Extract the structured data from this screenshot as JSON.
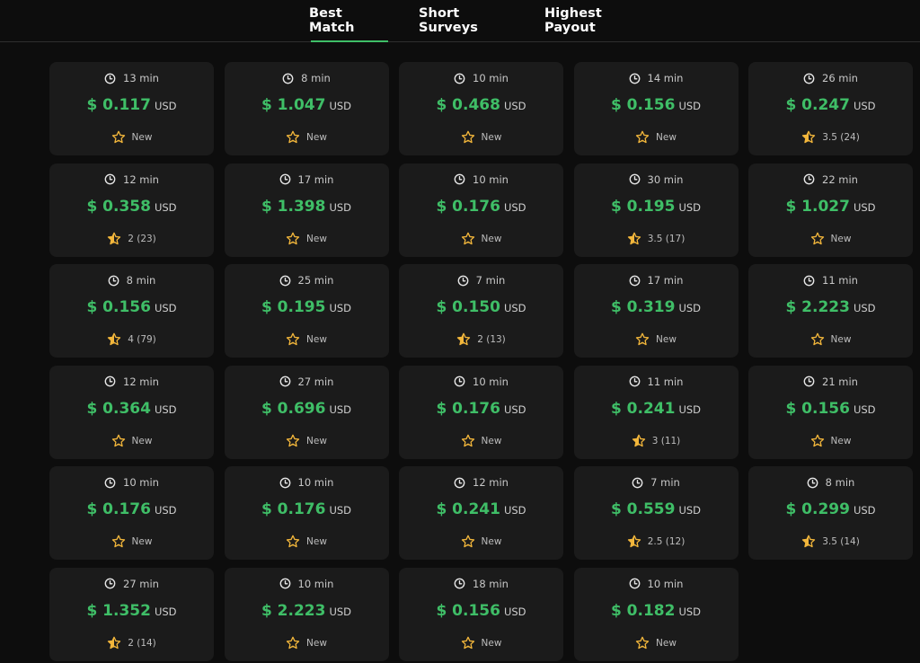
{
  "tabs": [
    {
      "label": "Best Match",
      "active": true
    },
    {
      "label": "Short Surveys",
      "active": false
    },
    {
      "label": "Highest Payout",
      "active": false
    }
  ],
  "colors": {
    "accent_green": "#3fbe67",
    "star_gold": "#f2b63b",
    "background": "#0d0d0d",
    "card": "#1b1b1b"
  },
  "currency": "USD",
  "surveys": [
    {
      "time": "13 min",
      "price": "$ 0.117",
      "rating": "New",
      "star": "empty-star-icon"
    },
    {
      "time": "8 min",
      "price": "$ 1.047",
      "rating": "New",
      "star": "empty-star-icon"
    },
    {
      "time": "10 min",
      "price": "$ 0.468",
      "rating": "New",
      "star": "empty-star-icon"
    },
    {
      "time": "14 min",
      "price": "$ 0.156",
      "rating": "New",
      "star": "empty-star-icon"
    },
    {
      "time": "26 min",
      "price": "$ 0.247",
      "rating": "3.5 (24)",
      "star": "half-star-icon"
    },
    {
      "time": "12 min",
      "price": "$ 0.358",
      "rating": "2 (23)",
      "star": "half-star-icon"
    },
    {
      "time": "17 min",
      "price": "$ 1.398",
      "rating": "New",
      "star": "empty-star-icon"
    },
    {
      "time": "10 min",
      "price": "$ 0.176",
      "rating": "New",
      "star": "empty-star-icon"
    },
    {
      "time": "30 min",
      "price": "$ 0.195",
      "rating": "3.5 (17)",
      "star": "half-star-icon"
    },
    {
      "time": "22 min",
      "price": "$ 1.027",
      "rating": "New",
      "star": "empty-star-icon"
    },
    {
      "time": "8 min",
      "price": "$ 0.156",
      "rating": "4 (79)",
      "star": "half-star-icon"
    },
    {
      "time": "25 min",
      "price": "$ 0.195",
      "rating": "New",
      "star": "empty-star-icon"
    },
    {
      "time": "7 min",
      "price": "$ 0.150",
      "rating": "2 (13)",
      "star": "half-star-icon"
    },
    {
      "time": "17 min",
      "price": "$ 0.319",
      "rating": "New",
      "star": "empty-star-icon"
    },
    {
      "time": "11 min",
      "price": "$ 2.223",
      "rating": "New",
      "star": "empty-star-icon"
    },
    {
      "time": "12 min",
      "price": "$ 0.364",
      "rating": "New",
      "star": "empty-star-icon"
    },
    {
      "time": "27 min",
      "price": "$ 0.696",
      "rating": "New",
      "star": "empty-star-icon"
    },
    {
      "time": "10 min",
      "price": "$ 0.176",
      "rating": "New",
      "star": "empty-star-icon"
    },
    {
      "time": "11 min",
      "price": "$ 0.241",
      "rating": "3 (11)",
      "star": "half-star-icon"
    },
    {
      "time": "21 min",
      "price": "$ 0.156",
      "rating": "New",
      "star": "empty-star-icon"
    },
    {
      "time": "10 min",
      "price": "$ 0.176",
      "rating": "New",
      "star": "empty-star-icon"
    },
    {
      "time": "10 min",
      "price": "$ 0.176",
      "rating": "New",
      "star": "empty-star-icon"
    },
    {
      "time": "12 min",
      "price": "$ 0.241",
      "rating": "New",
      "star": "empty-star-icon"
    },
    {
      "time": "7 min",
      "price": "$ 0.559",
      "rating": "2.5 (12)",
      "star": "half-star-icon"
    },
    {
      "time": "8 min",
      "price": "$ 0.299",
      "rating": "3.5 (14)",
      "star": "half-star-icon"
    },
    {
      "time": "27 min",
      "price": "$ 1.352",
      "rating": "2 (14)",
      "star": "half-star-icon"
    },
    {
      "time": "10 min",
      "price": "$ 2.223",
      "rating": "New",
      "star": "empty-star-icon"
    },
    {
      "time": "18 min",
      "price": "$ 0.156",
      "rating": "New",
      "star": "empty-star-icon"
    },
    {
      "time": "10 min",
      "price": "$ 0.182",
      "rating": "New",
      "star": "empty-star-icon"
    }
  ]
}
